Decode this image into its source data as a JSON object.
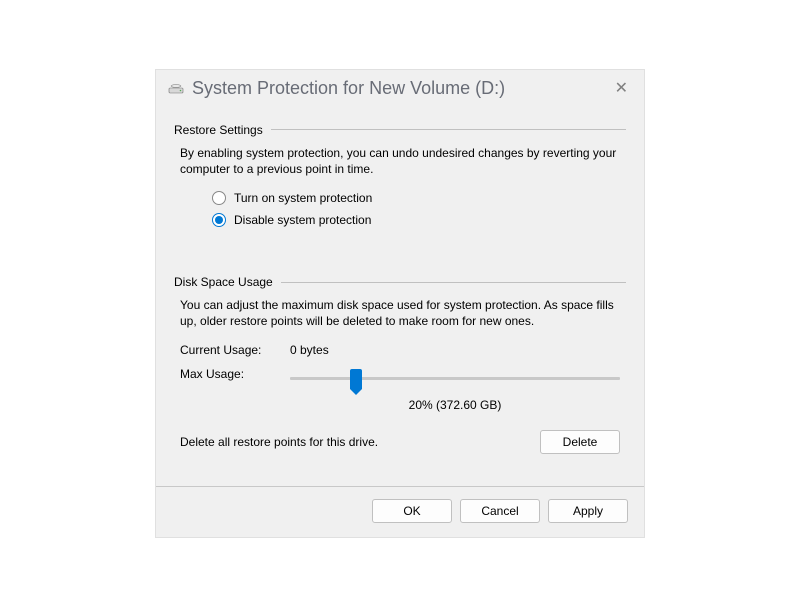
{
  "window": {
    "title": "System Protection for New Volume (D:)"
  },
  "restore": {
    "section_label": "Restore Settings",
    "description": "By enabling system protection, you can undo undesired changes by reverting your computer to a previous point in time.",
    "option_on": "Turn on system protection",
    "option_off": "Disable system protection",
    "selected": "off"
  },
  "disk": {
    "section_label": "Disk Space Usage",
    "description": "You can adjust the maximum disk space used for system protection. As space fills up, older restore points will be deleted to make room for new ones.",
    "current_label": "Current Usage:",
    "current_value": "0 bytes",
    "max_label": "Max Usage:",
    "slider_percent": 20,
    "slider_caption": "20% (372.60 GB)",
    "delete_text": "Delete all restore points for this drive.",
    "delete_button": "Delete"
  },
  "buttons": {
    "ok": "OK",
    "cancel": "Cancel",
    "apply": "Apply"
  }
}
